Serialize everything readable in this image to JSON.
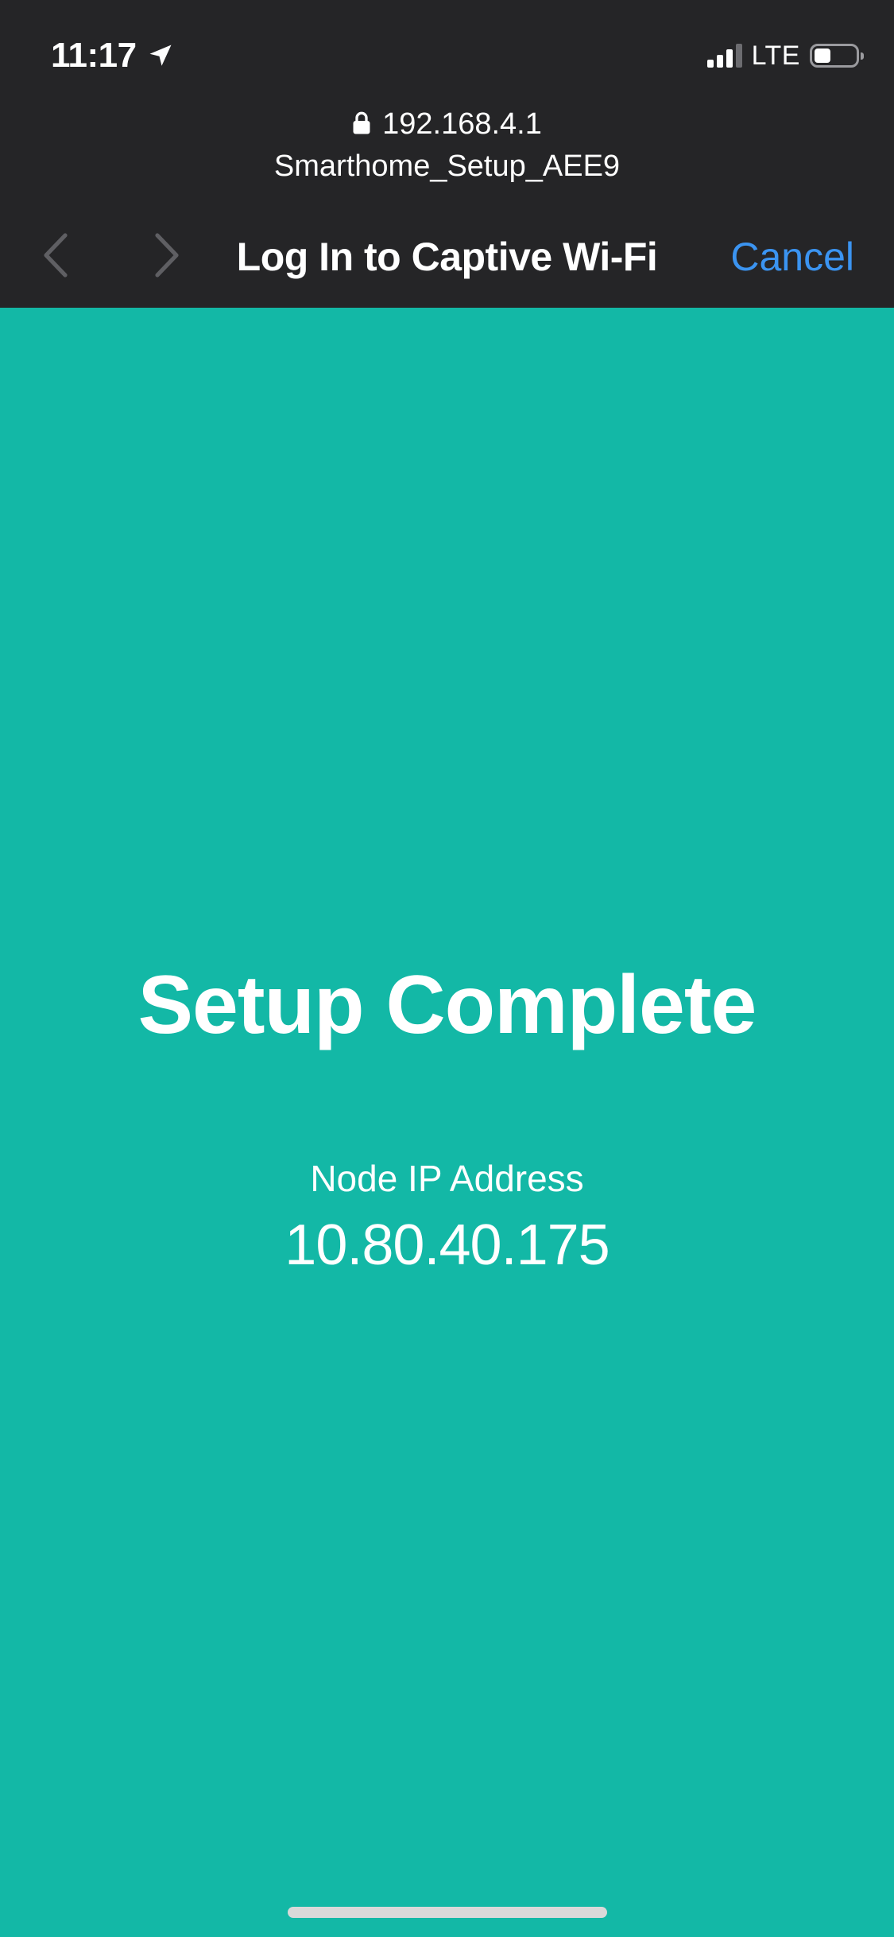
{
  "status_bar": {
    "time": "11:17",
    "location_icon": "location-arrow-icon",
    "network": "LTE",
    "signal_bars_active": 3,
    "signal_bars_total": 4,
    "battery_level": 0.3
  },
  "address_bar": {
    "url": "192.168.4.1",
    "lock_icon": "lock-icon",
    "site_name": "Smarthome_Setup_AEE9"
  },
  "nav_bar": {
    "back_icon": "chevron-left-icon",
    "forward_icon": "chevron-right-icon",
    "title": "Log In to Captive Wi-Fi",
    "cancel_label": "Cancel"
  },
  "content": {
    "heading": "Setup Complete",
    "ip_label": "Node IP Address",
    "ip_value": "10.80.40.175"
  },
  "colors": {
    "chrome_background": "#252527",
    "page_background": "#13b8a6",
    "accent": "#3b94f1",
    "text": "#ffffff"
  }
}
